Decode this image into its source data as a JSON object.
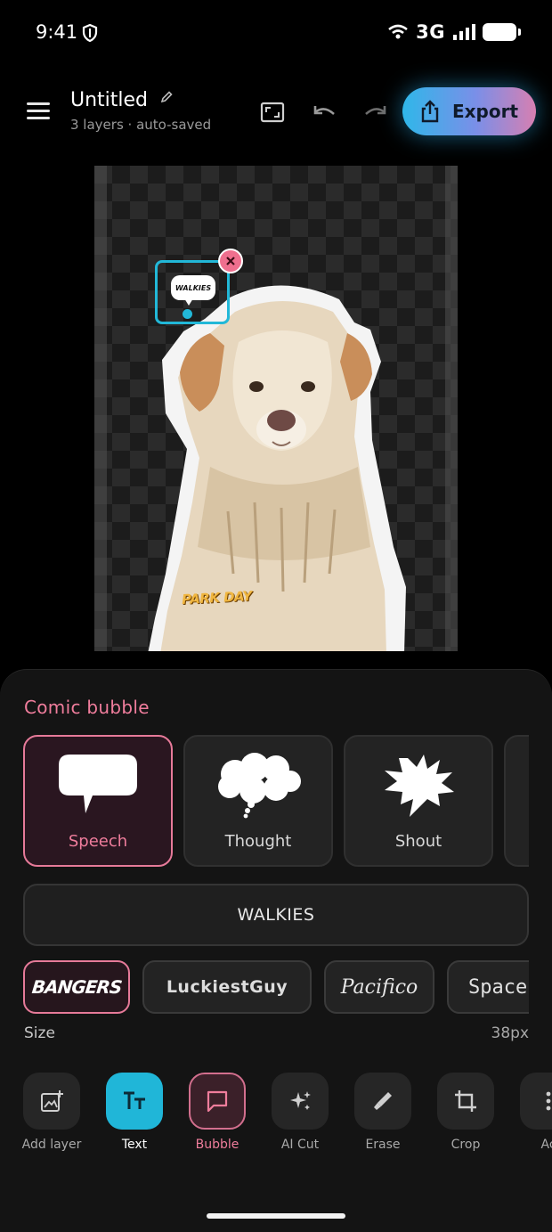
{
  "status_bar": {
    "time": "9:41",
    "network": "3G"
  },
  "header": {
    "title": "Untitled",
    "subtitle": "3 layers · auto-saved",
    "export_label": "Export"
  },
  "canvas": {
    "bubble_text": "WALKIES",
    "text_layer": "PARK DAY"
  },
  "panel": {
    "title": "Comic bubble",
    "bubble_styles": [
      {
        "label": "Speech",
        "selected": true
      },
      {
        "label": "Thought",
        "selected": false
      },
      {
        "label": "Shout",
        "selected": false
      }
    ],
    "text_value": "WALKIES",
    "fonts": [
      {
        "label": "BANGERS",
        "selected": true
      },
      {
        "label": "LuckiestGuy",
        "selected": false
      },
      {
        "label": "Pacifico",
        "selected": false
      },
      {
        "label": "Space",
        "selected": false
      }
    ],
    "size_label": "Size",
    "size_value": "38px"
  },
  "toolbar": {
    "tools": [
      {
        "label": "Add layer",
        "icon": "add-image-icon"
      },
      {
        "label": "Text",
        "icon": "text-icon",
        "selected": true
      },
      {
        "label": "Bubble",
        "icon": "speech-bubble-icon",
        "active": true
      },
      {
        "label": "AI Cut",
        "icon": "sparkles-icon"
      },
      {
        "label": "Erase",
        "icon": "eraser-icon"
      },
      {
        "label": "Crop",
        "icon": "crop-icon"
      },
      {
        "label": "Ac",
        "icon": "more-icon"
      }
    ]
  },
  "colors": {
    "accent_pink": "#e67a99",
    "accent_cyan": "#20b6d8"
  }
}
